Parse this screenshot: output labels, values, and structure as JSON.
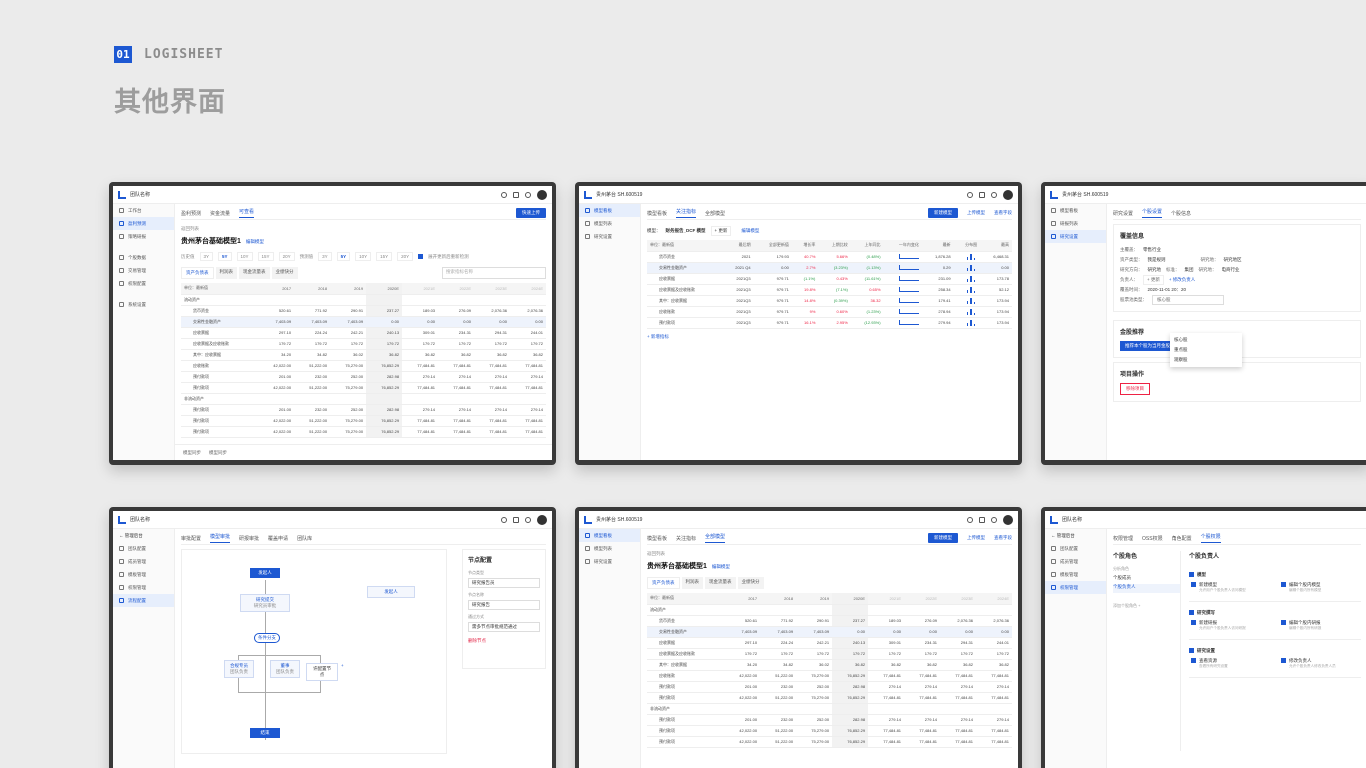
{
  "header": {
    "number": "01",
    "brand": "LOGISHEET",
    "title": "其他界面"
  },
  "colors": {
    "accent": "#1d58d2",
    "background": "#ebebeb",
    "frame": "#393939",
    "danger": "#e22244"
  },
  "common": {
    "team": "团队名称",
    "stock": "贵州茅台  SH.600519",
    "model_title": "贵州茅台基础模型1",
    "crumb": "返回列表",
    "edit_model": "编辑模型",
    "add_indicator": "+ 新增指标"
  },
  "s1": {
    "side": [
      "工作台",
      "盈利预测",
      "策略研报",
      "个股数据",
      "交易管理",
      "权限配置",
      "系统设置"
    ],
    "tabs": [
      "盈利预测",
      "资金流量",
      "可查看"
    ],
    "btn": "快速上传",
    "filters": {
      "label1": "历史值",
      "years1": [
        "3Y",
        "5Y",
        "10Y",
        "15Y",
        "20Y"
      ],
      "label2": "预测值",
      "years2": [
        "3Y",
        "5Y",
        "10Y",
        "15Y",
        "20Y"
      ],
      "check": "展开更新后重新检测"
    },
    "subtabs": [
      "资产负债表",
      "利润表",
      "现金流量表",
      "业绩快分"
    ],
    "search": "搜索指标名称",
    "footer": [
      "模型同步",
      "模型同步"
    ]
  },
  "fin_table": {
    "cols": [
      "单位：最新值",
      "2017",
      "2018",
      "2019",
      "2020E",
      "2021E",
      "2022E",
      "2023E",
      "2024E"
    ],
    "rows": [
      {
        "n": "流动资产",
        "g": true,
        "v": []
      },
      {
        "n": "货币资金",
        "v": [
          "520.61",
          "771.92",
          "290.91",
          "237.27",
          "189.03",
          "276.09",
          "2,076.36",
          "2,076.36"
        ]
      },
      {
        "n": "交易性金融资产",
        "v": [
          "7,403.09",
          "7,403.09",
          "7,403.09",
          "0.00",
          "0.00",
          "0.00",
          "0.00",
          "0.00"
        ],
        "hl": true
      },
      {
        "n": "应收票据",
        "v": [
          "297.10",
          "224.24",
          "242.21",
          "240.13",
          "309.01",
          "234.31",
          "294.31",
          "244.01"
        ]
      },
      {
        "n": "应收票据及应收账款",
        "v": [
          "179.72",
          "179.72",
          "179.72",
          "179.72",
          "179.72",
          "179.72",
          "179.72",
          "179.72"
        ]
      },
      {
        "n": "其中：应收票据",
        "v": [
          "34.20",
          "34.82",
          "36.02",
          "36.82",
          "36.82",
          "36.82",
          "36.82",
          "36.82"
        ]
      },
      {
        "n": "应收账款",
        "v": [
          "42,022.00",
          "51,222.00",
          "75,279.00",
          "76,852.29",
          "77,484.81",
          "77,484.81",
          "77,484.81",
          "77,484.81"
        ]
      },
      {
        "n": "预付款项",
        "v": [
          "201.00",
          "232.00",
          "252.00",
          "282.98",
          "279.14",
          "279.14",
          "279.14",
          "279.14"
        ]
      },
      {
        "n": "预付款项",
        "v": [
          "42,022.00",
          "51,222.00",
          "75,279.00",
          "76,852.29",
          "77,484.81",
          "77,484.81",
          "77,484.81",
          "77,484.81"
        ]
      },
      {
        "n": "非流动资产",
        "g": true,
        "v": []
      },
      {
        "n": "预付款项",
        "v": [
          "201.00",
          "232.00",
          "252.00",
          "282.98",
          "279.14",
          "279.14",
          "279.14",
          "279.14"
        ]
      },
      {
        "n": "预付款项",
        "v": [
          "42,022.00",
          "51,222.00",
          "75,279.00",
          "76,852.29",
          "77,484.81",
          "77,484.81",
          "77,484.81",
          "77,484.81"
        ]
      },
      {
        "n": "预付款项",
        "v": [
          "42,022.00",
          "51,222.00",
          "75,279.00",
          "76,852.29",
          "77,484.81",
          "77,484.81",
          "77,484.81",
          "77,484.81"
        ]
      }
    ]
  },
  "s2": {
    "side": [
      "模型看板",
      "模型列表",
      "研究设置"
    ],
    "tabs": [
      "模型看板",
      "关注指标",
      "全部模型"
    ],
    "btn1": "新建模型",
    "btn2": "上传模型",
    "btn3": "查看字段",
    "model_label": "模型：",
    "model_name": "财务报告_DCF 模型",
    "model_tag": "+ 更新",
    "cols": [
      "单位：最新值",
      "最后期",
      "全部更新值",
      "增长率",
      "上期比较",
      "上年同比",
      "一年内变化",
      "最新",
      "分布图",
      "最高"
    ],
    "rows": [
      {
        "n": "货币资金",
        "v": [
          "2021",
          "179.93",
          "40.7%",
          "5.66%",
          "(0.48%)",
          "1,876.28",
          "6,468.31"
        ]
      },
      {
        "n": "交易性金融资产",
        "v": [
          "2021 Q4",
          "0.00",
          "2.7%",
          "(3.23%)",
          "(1.13%)",
          "0.29",
          "0.00"
        ],
        "hl": true
      },
      {
        "n": "应收票据",
        "v": [
          "2021Q3",
          "979.71",
          "(1.1%)",
          "0.43%",
          "(11.61%)",
          "231.09",
          "173.78"
        ]
      },
      {
        "n": "应收票据及应收账款",
        "v": [
          "2021Q3",
          "979.71",
          "19.8%",
          "(7.1%)",
          "0.65%",
          "258.34",
          "52.12"
        ]
      },
      {
        "n": "其中：应收票据",
        "v": [
          "2021Q3",
          "979.71",
          "14.8%",
          "(0.39%)",
          "36.32",
          "179.41",
          "173.94"
        ]
      },
      {
        "n": "应收账款",
        "v": [
          "2021Q3",
          "979.71",
          "9%",
          "0.60%",
          "(1.23%)",
          "278.94",
          "173.94"
        ]
      },
      {
        "n": "预付款项",
        "v": [
          "2021Q3",
          "979.71",
          "16.1%",
          "2.95%",
          "(12.93%)",
          "279.94",
          "173.94"
        ]
      }
    ]
  },
  "s3": {
    "side": [
      "模型看板",
      "研报列表",
      "研究设置"
    ],
    "tabs": [
      "研究设置",
      "个股设置",
      "个股信息"
    ],
    "cover_title": "覆盖信息",
    "f_industry_l": "主覆盖：",
    "f_industry": "零售行业",
    "f_s1": "资产类型：",
    "f_s1v": "我是规则",
    "f_s2": "研究地：",
    "f_s2v": "研究地区",
    "f_type": "研究方向：",
    "f_typev": "研究地",
    "f_area": "标准：",
    "f_areav": "集团",
    "f_research": "研究地：",
    "f_researchv": "电商行业",
    "f_owner": "负责人：",
    "f_owner_tag": "+ 更新",
    "f_owner_add": "+ 修改负责人",
    "f_time": "覆盖时间：",
    "f_timev": "2020-11-01 20：20",
    "f_pool": "股票池类型：",
    "f_poolv": "核心股",
    "pool_options": [
      "核心股",
      "重点股",
      "观察股"
    ],
    "rec_title": "金股推荐",
    "rec_btn": "推荐本个股为当月金股",
    "op_title": "项目操作",
    "op_btn": "移除项目"
  },
  "s4": {
    "back": "← 管理后台",
    "side": [
      "团队配置",
      "成员管理",
      "模板管理",
      "权限管理",
      "流程配置"
    ],
    "tabs": [
      "审批配置",
      "模型审批",
      "研报审批",
      "覆盖申请",
      "团队库"
    ],
    "nodes": {
      "start": "发起人",
      "research": "研究提交",
      "research_sub": "研究员审批",
      "add": "条件分支",
      "left": "合规专员",
      "left_sub": "团队负责",
      "mid": "董事",
      "mid_sub": "团队负责",
      "right": "许配置节点",
      "end": "结束",
      "float": "发起人"
    },
    "panel": {
      "title": "节点配置",
      "l1": "节点类型",
      "v1": "研究报告员",
      "l2": "节点名称",
      "v2": "研究报告",
      "l3": "通过方式",
      "v3": "需多节点审批规范通过",
      "del": "删除节点"
    }
  },
  "s5": {
    "side": [
      "模型看板",
      "模型列表",
      "研究设置"
    ],
    "tabs": [
      "模型看板",
      "关注指标",
      "全部模型"
    ],
    "btn1": "新建模型",
    "btn2": "上传模型",
    "btn3": "查看字段"
  },
  "s6": {
    "back": "← 管理后台",
    "side": [
      "团队配置",
      "成员管理",
      "模板管理",
      "权限管理"
    ],
    "tabs": [
      "权限管理",
      "OSS权限",
      "角色配置",
      "个股权限"
    ],
    "roles_title": "个股角色",
    "roles": [
      "分析角色",
      "个股成员",
      "个股负责人"
    ],
    "roles_add": "添加个股角色  +",
    "perm_title": "个股负责人",
    "groups": [
      {
        "name": "模型",
        "items": [
          {
            "t": "新建模型",
            "d": "允许用户个股负责人访问模型"
          },
          {
            "t": "编辑个股内模型",
            "d": "编辑个股内所有模型"
          }
        ]
      },
      {
        "name": "研究撰写",
        "items": [
          {
            "t": "新建研报",
            "d": "允许用户个股负责人访问研报"
          },
          {
            "t": "编辑个股内研报",
            "d": "编辑个股内所有研报"
          }
        ]
      },
      {
        "name": "研究设置",
        "items": [
          {
            "t": "查看资源",
            "d": "查看所有研究设置"
          },
          {
            "t": "修改负责人",
            "d": "允许个股负责人修改负责人员"
          }
        ]
      }
    ]
  }
}
